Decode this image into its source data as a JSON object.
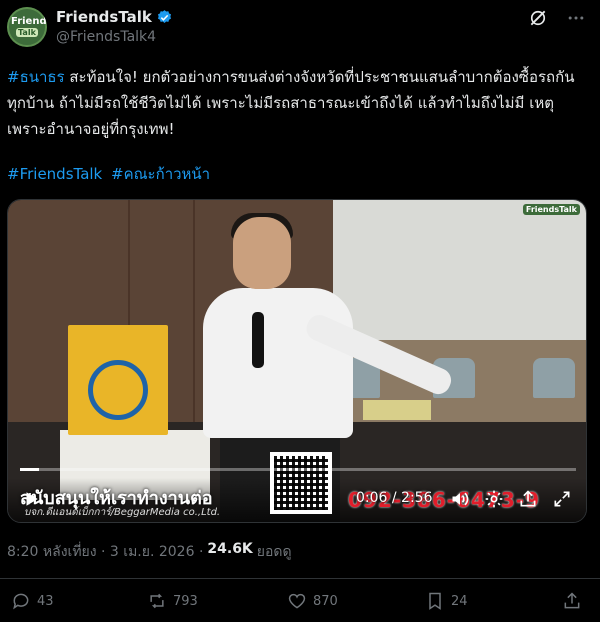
{
  "author": {
    "display_name": "FriendsTalk",
    "handle": "@FriendsTalk4",
    "avatar_line1": "Friends",
    "avatar_line2": "Talk"
  },
  "tweet": {
    "hashtag_lead": "#ธนาธร",
    "body": " สะท้อนใจ! ยกตัวอย่างการขนส่งต่างจังหวัดที่ประชาชนแสนลำบากต้องซื้อรถกันทุกบ้าน ถ้าไม่มีรถใช้ชีวิตไม่ได้ เพราะไม่มีรถสาธารณะเข้าถึงได้ แล้วทำไมถึงไม่มี เหตุเพราะอำนาจอยู่ที่กรุงเทพ!",
    "hashtags": [
      "#FriendsTalk",
      "#คณะก้าวหน้า"
    ]
  },
  "video": {
    "caption_main": "สนับสนุนให้เราทำงานต่อ",
    "caption_sub": "บจก.ดีแอนด์เบ็กการ์/BeggarMedia co.,Ltd.",
    "phone_overlay": "092-386-6473-9",
    "watermark": "FriendsTalk",
    "time": "0:06 / 2:56",
    "progress": 0.034
  },
  "meta": {
    "timestamp": "8:20 หลังเที่ยง · 3 เม.ย. 2026 ·",
    "views_count": "24.6K",
    "views_label": "ยอดดู"
  },
  "actions": {
    "replies": "43",
    "reposts": "793",
    "likes": "870",
    "bookmarks": "24"
  },
  "colors": {
    "link": "#1d9bf0",
    "muted": "#71767b",
    "text": "#e7e9ea",
    "background": "#000000"
  }
}
